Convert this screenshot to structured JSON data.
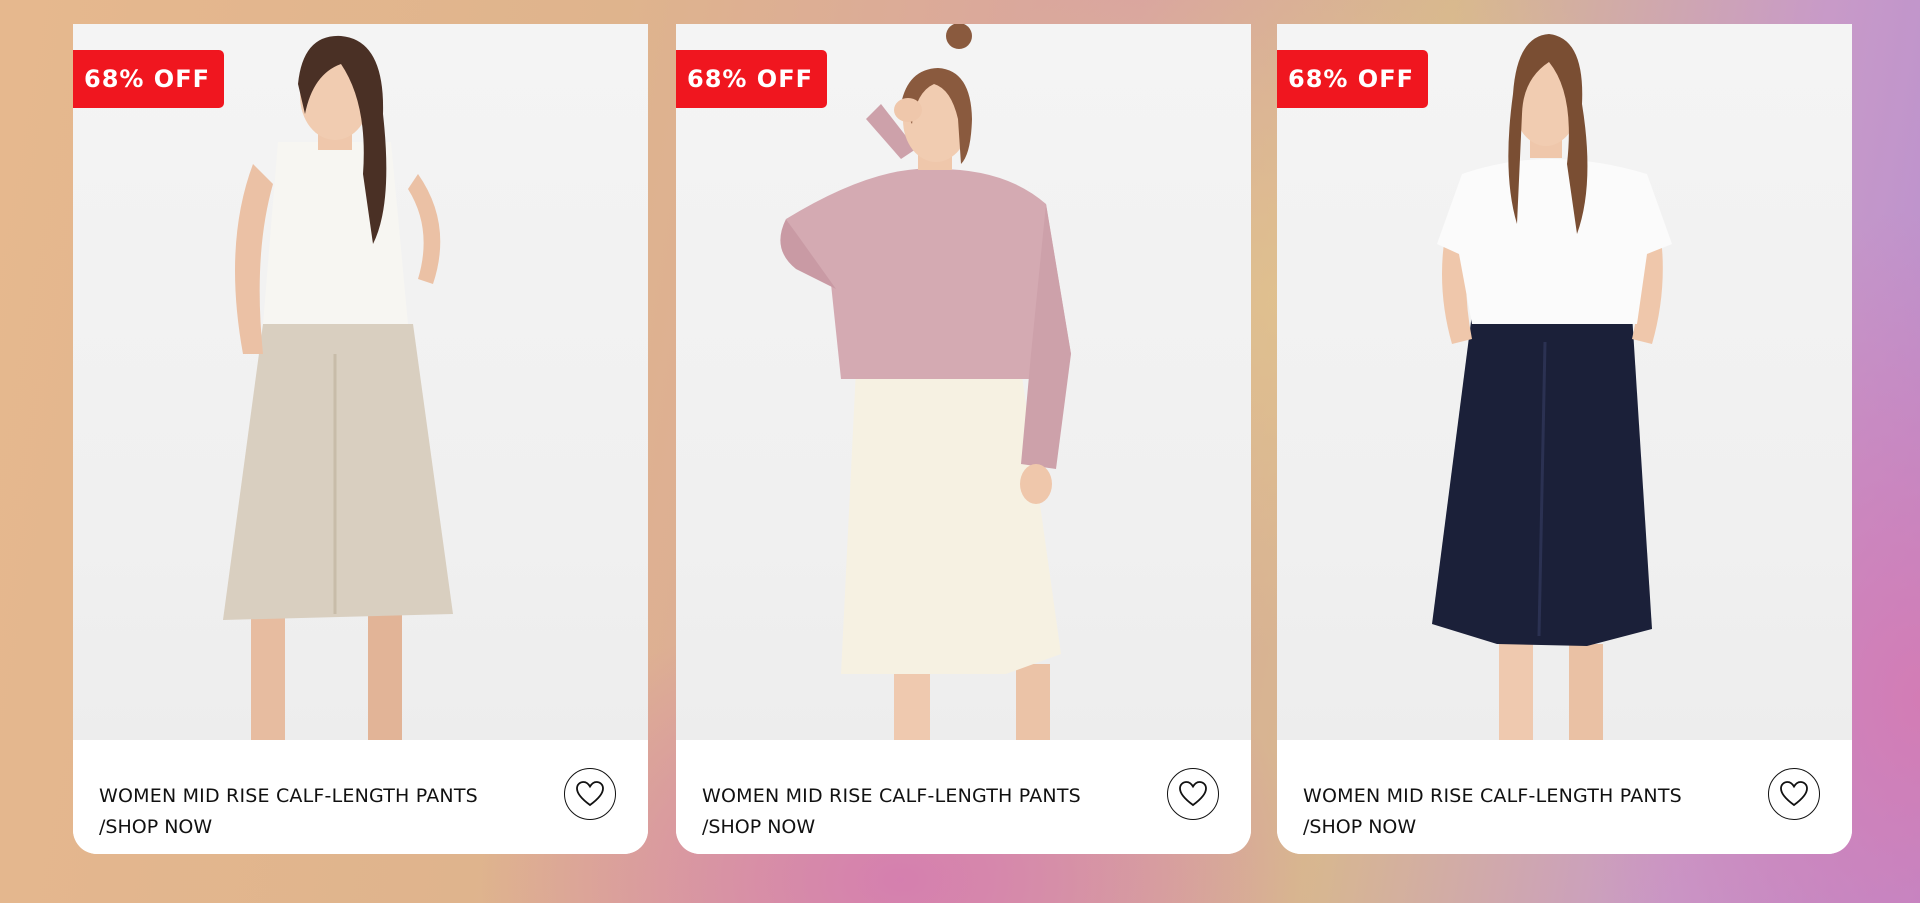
{
  "products": [
    {
      "badge": "68% OFF",
      "title": "WOMEN MID RISE CALF-LENGTH PANTS",
      "cta": "/SHOP NOW",
      "top_color": "#f7f6f2",
      "pants_color": "#d9cfc0",
      "hair_color": "#4a3025"
    },
    {
      "badge": "68% OFF",
      "title": "WOMEN MID RISE CALF-LENGTH PANTS",
      "cta": "/SHOP NOW",
      "top_color": "#d4aab2",
      "pants_color": "#f6f1e2",
      "hair_color": "#8a5a3e"
    },
    {
      "badge": "68% OFF",
      "title": "WOMEN MID RISE CALF-LENGTH PANTS",
      "cta": "/SHOP NOW",
      "top_color": "#fbfbfb",
      "pants_color": "#1b2039",
      "hair_color": "#7a4e33"
    }
  ],
  "colors": {
    "badge_bg": "#f0161f",
    "card_bg": "#ffffff"
  },
  "icons": {
    "wishlist": "heart-outline-icon"
  }
}
